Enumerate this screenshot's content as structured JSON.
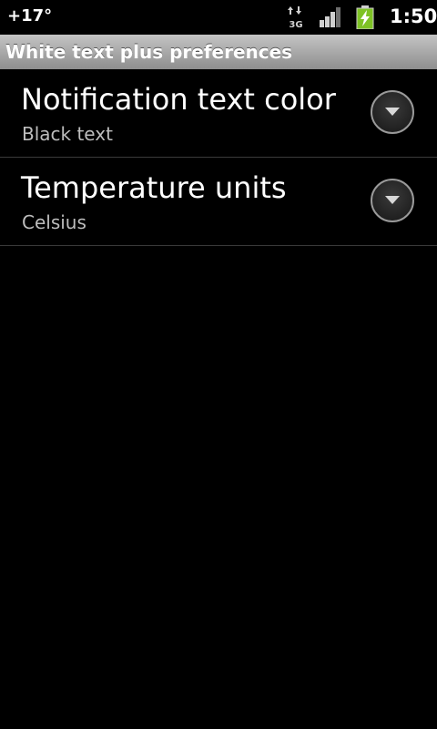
{
  "status_bar": {
    "temperature": "+17°",
    "network_type": "3G",
    "network_icon": "network-3g-icon",
    "signal_icon": "signal-strength-icon",
    "battery_icon": "battery-charging-icon",
    "time": "1:50"
  },
  "title_bar": {
    "title": "White text plus preferences"
  },
  "preferences": [
    {
      "title": "Notification text color",
      "summary": "Black text",
      "control_icon": "chevron-down-icon"
    },
    {
      "title": "Temperature units",
      "summary": "Celsius",
      "control_icon": "chevron-down-icon"
    }
  ],
  "colors": {
    "background": "#000000",
    "title_bar_top": "#c4c4c4",
    "title_bar_bottom": "#8e8e8e",
    "summary_text": "#bdbdbd",
    "battery_fill": "#7ec225",
    "divider": "#3a3a3a"
  }
}
